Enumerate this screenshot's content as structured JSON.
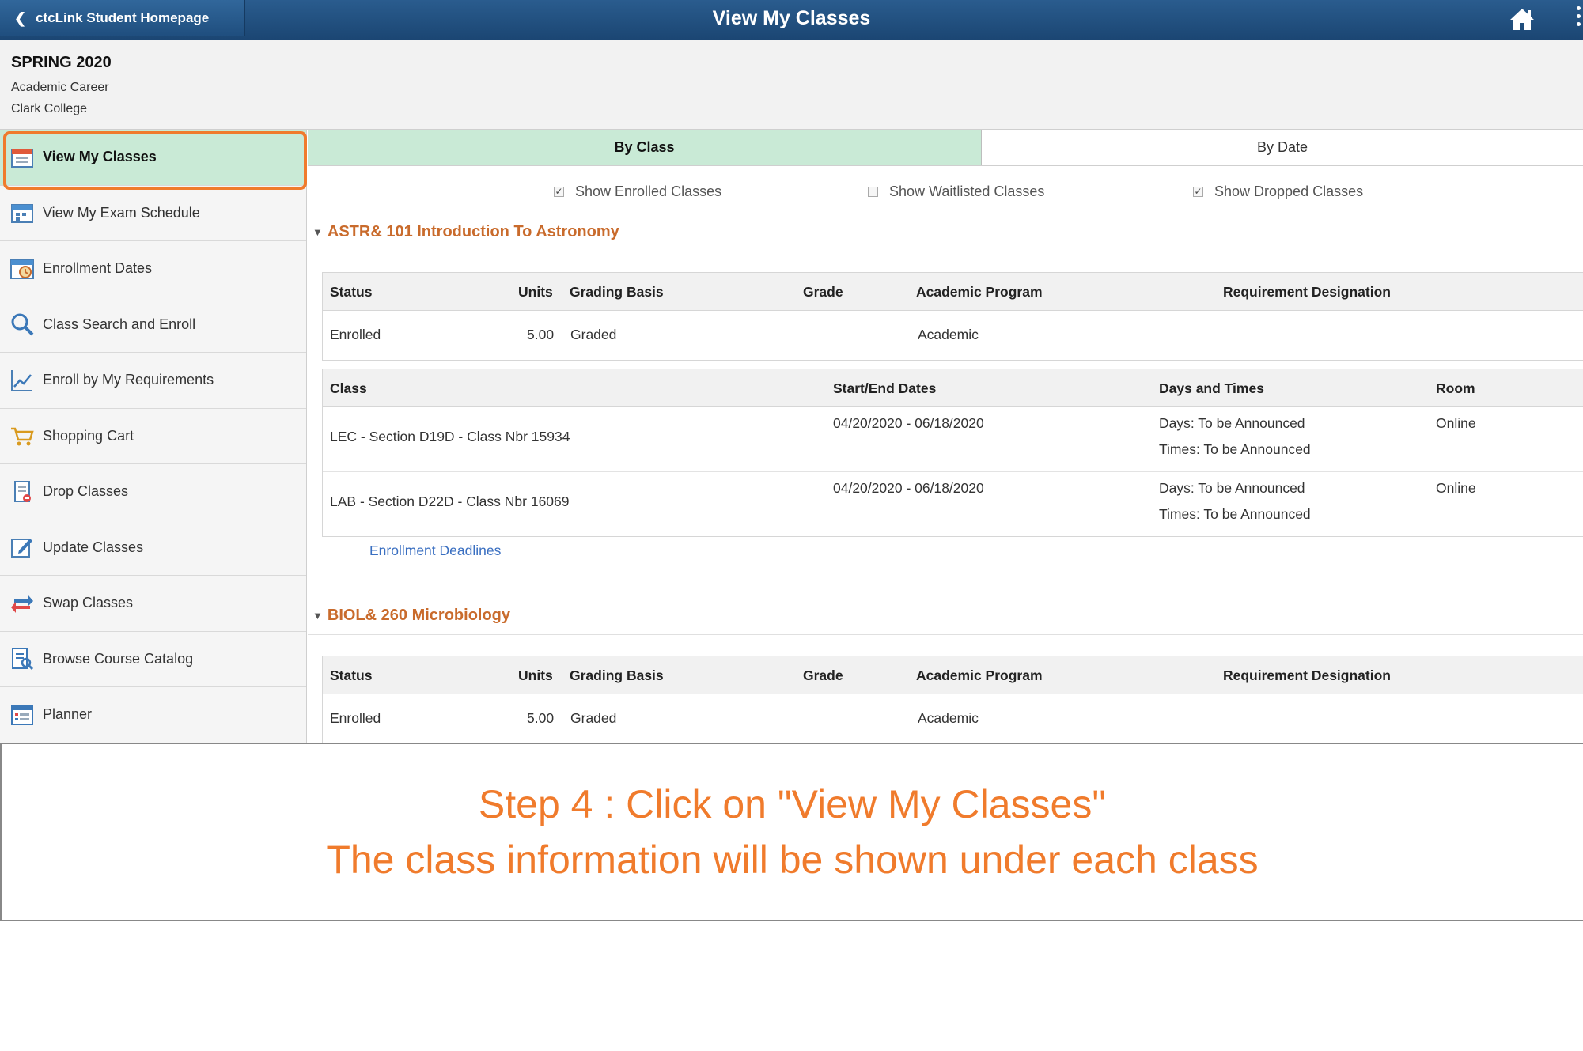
{
  "header": {
    "back_label": "ctcLink Student Homepage",
    "title": "View My Classes"
  },
  "term": {
    "title": "SPRING 2020",
    "career": "Academic Career",
    "institution": "Clark College"
  },
  "sidebar": {
    "items": [
      {
        "label": "View My Classes",
        "icon": "calendar-icon",
        "active": true
      },
      {
        "label": "View My Exam Schedule",
        "icon": "calendar-icon"
      },
      {
        "label": "Enrollment Dates",
        "icon": "calendar-clock-icon"
      },
      {
        "label": "Class Search and Enroll",
        "icon": "search-icon"
      },
      {
        "label": "Enroll by My Requirements",
        "icon": "chart-icon"
      },
      {
        "label": "Shopping Cart",
        "icon": "cart-icon"
      },
      {
        "label": "Drop Classes",
        "icon": "document-drop-icon"
      },
      {
        "label": "Update Classes",
        "icon": "edit-icon"
      },
      {
        "label": "Swap Classes",
        "icon": "swap-icon"
      },
      {
        "label": "Browse Course Catalog",
        "icon": "catalog-icon"
      },
      {
        "label": "Planner",
        "icon": "planner-icon"
      }
    ]
  },
  "tabs": {
    "by_class": "By Class",
    "by_date": "By Date"
  },
  "filters": {
    "enrolled": {
      "label": "Show Enrolled Classes",
      "checked": true
    },
    "waitlisted": {
      "label": "Show Waitlisted Classes",
      "checked": false
    },
    "dropped": {
      "label": "Show Dropped Classes",
      "checked": true
    }
  },
  "status_headers": {
    "status": "Status",
    "units": "Units",
    "grading": "Grading Basis",
    "grade": "Grade",
    "program": "Academic Program",
    "requirement": "Requirement Designation"
  },
  "class_headers": {
    "class": "Class",
    "dates": "Start/End Dates",
    "days_times": "Days and Times",
    "room": "Room"
  },
  "courses": [
    {
      "title": "ASTR& 101 Introduction To Astronomy",
      "status": {
        "status": "Enrolled",
        "units": "5.00",
        "grading": "Graded",
        "grade": "",
        "program": "Academic",
        "requirement": ""
      },
      "sections": [
        {
          "class": "LEC - Section D19D - Class Nbr 15934",
          "dates": "04/20/2020 - 06/18/2020",
          "days": "Days: To be Announced",
          "times": "Times: To be Announced",
          "room": "Online"
        },
        {
          "class": "LAB - Section D22D - Class Nbr 16069",
          "dates": "04/20/2020 - 06/18/2020",
          "days": "Days: To be Announced",
          "times": "Times: To be Announced",
          "room": "Online"
        }
      ],
      "deadlines_label": "Enrollment Deadlines"
    },
    {
      "title": "BIOL& 260 Microbiology",
      "status": {
        "status": "Enrolled",
        "units": "5.00",
        "grading": "Graded",
        "grade": "",
        "program": "Academic",
        "requirement": ""
      }
    }
  ],
  "caption": {
    "line1": "Step 4 : Click on \"View My Classes\"",
    "line2": "The class information will  be shown under each class"
  },
  "colors": {
    "header": "#1b4673",
    "active_tab": "#c9ead6",
    "course_title": "#c96b2c",
    "highlight": "#f07b2c",
    "link": "#3a6fc1"
  }
}
